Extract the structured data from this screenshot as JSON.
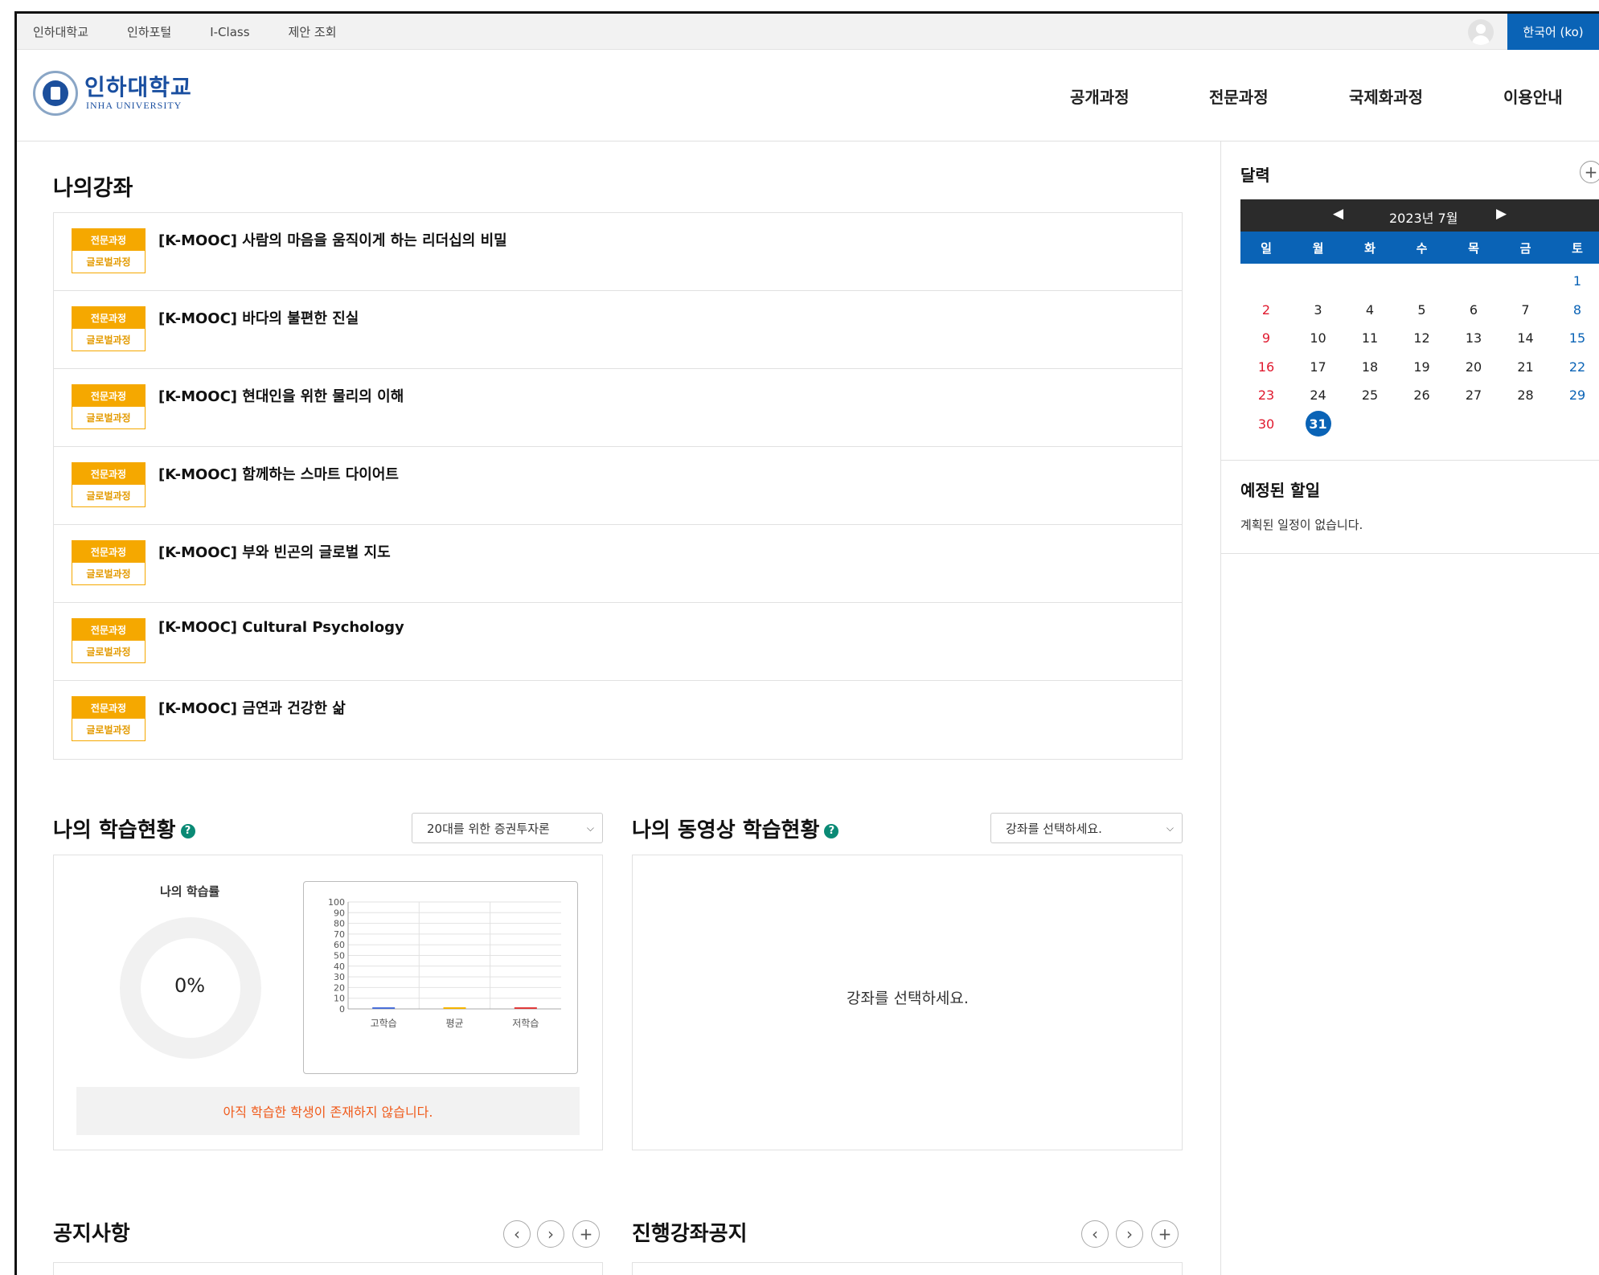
{
  "topbar": {
    "links": [
      "인하대학교",
      "인하포털",
      "I-Class",
      "제안 조회"
    ],
    "language": "한국어 (ko)"
  },
  "header": {
    "logo_kr": "인하대학교",
    "logo_en": "INHA UNIVERSITY",
    "nav": [
      "공개과정",
      "전문과정",
      "국제화과정",
      "이용안내"
    ]
  },
  "my_courses": {
    "title": "나의강좌",
    "items": [
      {
        "tag1": "전문과정",
        "tag2": "글로벌과정",
        "title": "[K-MOOC] 사람의 마음을 움직이게 하는 리더십의 비밀"
      },
      {
        "tag1": "전문과정",
        "tag2": "글로벌과정",
        "title": "[K-MOOC] 바다의 불편한 진실"
      },
      {
        "tag1": "전문과정",
        "tag2": "글로벌과정",
        "title": "[K-MOOC] 현대인을 위한 물리의 이해"
      },
      {
        "tag1": "전문과정",
        "tag2": "글로벌과정",
        "title": "[K-MOOC] 함께하는 스마트 다이어트"
      },
      {
        "tag1": "전문과정",
        "tag2": "글로벌과정",
        "title": "[K-MOOC] 부와 빈곤의 글로벌 지도"
      },
      {
        "tag1": "전문과정",
        "tag2": "글로벌과정",
        "title": "[K-MOOC] Cultural Psychology"
      },
      {
        "tag1": "전문과정",
        "tag2": "글로벌과정",
        "title": "[K-MOOC] 금연과 건강한 삶"
      }
    ]
  },
  "learning_status": {
    "title": "나의 학습현황",
    "help": "?",
    "select_value": "20대를 위한 증권투자론",
    "donut_label": "나의 학습률",
    "donut_value": "0%",
    "progress_fraction": 0,
    "notice": "아직 학습한 학생이 존재하지 않습니다."
  },
  "chart_data": {
    "type": "bar",
    "categories": [
      "고학습",
      "평균",
      "저학습"
    ],
    "values": [
      0,
      0,
      0
    ],
    "ylim": [
      0,
      100
    ],
    "yticks": [
      0,
      10,
      20,
      30,
      40,
      50,
      60,
      70,
      80,
      90,
      100
    ],
    "colors": [
      "#4a6fd8",
      "#f5b400",
      "#e03a3a"
    ],
    "grid": true
  },
  "video_status": {
    "title": "나의 동영상 학습현황",
    "help": "?",
    "select_value": "강좌를 선택하세요.",
    "empty": "강좌를 선택하세요."
  },
  "notices": {
    "title": "공지사항",
    "prev": "‹",
    "next": "›",
    "add": "+"
  },
  "course_notices": {
    "title": "진행강좌공지",
    "prev": "‹",
    "next": "›",
    "add": "+"
  },
  "calendar": {
    "title": "달력",
    "add": "+",
    "prev": "◀",
    "next": "▶",
    "month": "2023년 7월",
    "weekdays": [
      "일",
      "월",
      "화",
      "수",
      "목",
      "금",
      "토"
    ],
    "first_weekday": 6,
    "days": 31,
    "today": 31
  },
  "upcoming": {
    "title": "예정된 할일",
    "empty": "계획된 일정이 없습니다."
  }
}
